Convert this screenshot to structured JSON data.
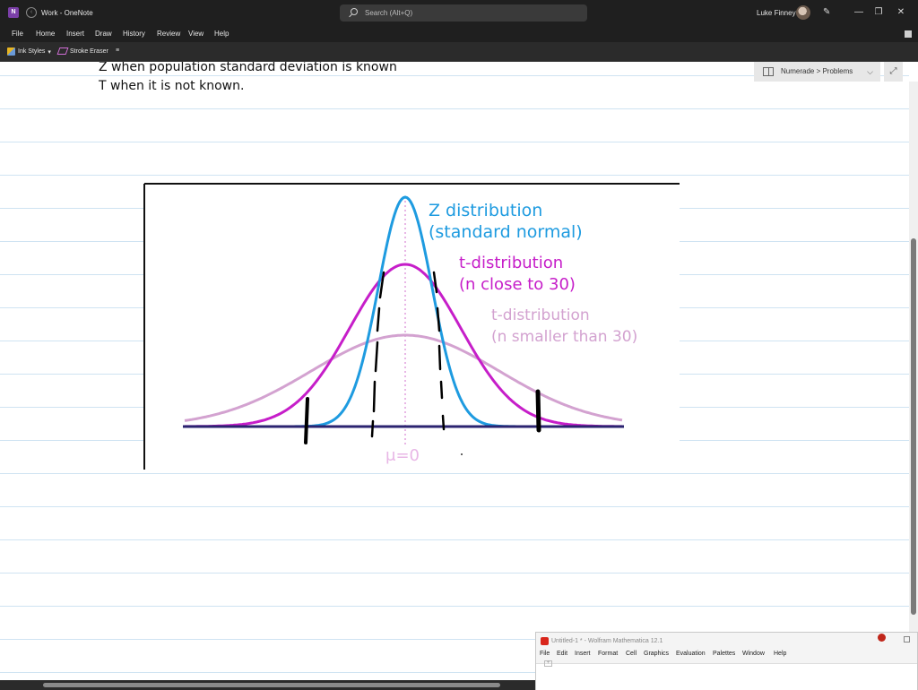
{
  "titlebar": {
    "app_icon": "onenote-icon",
    "title": "Work - OneNote",
    "search_placeholder": "Search (Alt+Q)",
    "user_name": "Luke Finney"
  },
  "menu": {
    "items": [
      "File",
      "Home",
      "Insert",
      "Draw",
      "History",
      "Review",
      "View",
      "Help"
    ]
  },
  "ribbon": {
    "ink_styles": "Ink Styles",
    "stroke_eraser": "Stroke Eraser",
    "more": "≡"
  },
  "notebook": {
    "breadcrumb": "Numerade > Problems"
  },
  "note": {
    "line1": "Z when population standard deviation is known",
    "line2": "T when it is not known."
  },
  "figure": {
    "z_label_1": "Z distribution",
    "z_label_2": "(standard normal)",
    "t30_label_1": "t-distribution",
    "t30_label_2": "(n close to 30)",
    "tsmall_label_1": "t-distribution",
    "tsmall_label_2": "(n smaller than 30)",
    "mean_label": "μ=0",
    "colors": {
      "z": "#1e9be0",
      "t_close": "#c61ec9",
      "t_small": "#d3a2d0",
      "mean": "#e8b7e6",
      "axis": "#2b2470"
    }
  },
  "mathematica": {
    "title": "Untitled-1 * - Wolfram Mathematica 12.1",
    "menu": [
      "File",
      "Edit",
      "Insert",
      "Format",
      "Cell",
      "Graphics",
      "Evaluation",
      "Palettes",
      "Window",
      "Help"
    ]
  }
}
